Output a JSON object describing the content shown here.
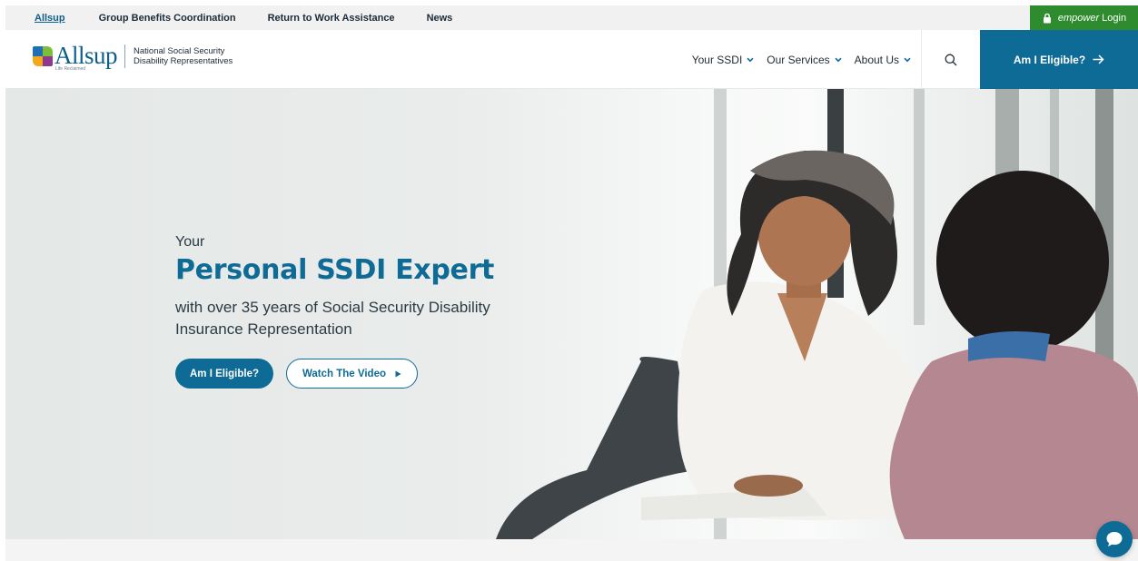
{
  "utility_nav": {
    "items": [
      "Allsup",
      "Group Benefits Coordination",
      "Return to Work Assistance",
      "News"
    ],
    "login": {
      "brand": "empower",
      "label": "Login"
    }
  },
  "header": {
    "logo": {
      "word": "Allsup",
      "tagline_small": "Life Reclaimed",
      "tag_line1": "National Social Security",
      "tag_line2": "Disability Representatives"
    },
    "nav": [
      "Your SSDI",
      "Our Services",
      "About Us"
    ],
    "cta": "Am I Eligible?"
  },
  "hero": {
    "eyebrow": "Your",
    "title": "Personal SSDI Expert",
    "description": "with over 35 years of Social Security Disability Insurance Representation",
    "primary_button": "Am I Eligible?",
    "secondary_button": "Watch The Video"
  },
  "colors": {
    "brand_blue": "#0e6b96",
    "login_green": "#2e8b2e"
  },
  "icons": [
    "lock-icon",
    "chevron-down-icon",
    "search-icon",
    "arrow-right-icon",
    "play-icon",
    "chat-icon"
  ]
}
